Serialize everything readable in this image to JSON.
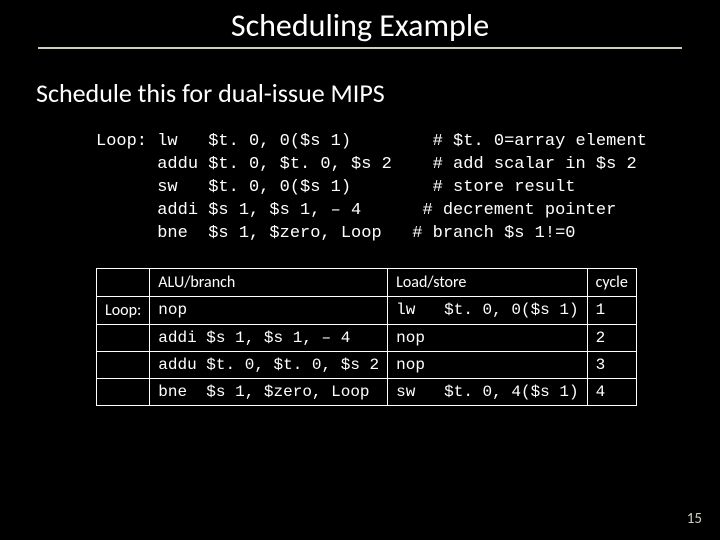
{
  "title": "Scheduling Example",
  "subtitle": "Schedule this for dual-issue MIPS",
  "code": "Loop: lw   $t. 0, 0($s 1)        # $t. 0=array element\n      addu $t. 0, $t. 0, $s 2    # add scalar in $s 2\n      sw   $t. 0, 0($s 1)        # store result\n      addi $s 1, $s 1, – 4      # decrement pointer\n      bne  $s 1, $zero, Loop   # branch $s 1!=0",
  "table": {
    "headers": [
      "",
      "ALU/branch",
      "Load/store",
      "cycle"
    ],
    "rows": [
      [
        "Loop:",
        "nop",
        "lw   $t. 0, 0($s 1)",
        "1"
      ],
      [
        "",
        "addi $s 1, $s 1, – 4",
        "nop",
        "2"
      ],
      [
        "",
        "addu $t. 0, $t. 0, $s 2",
        "nop",
        "3"
      ],
      [
        "",
        "bne  $s 1, $zero, Loop",
        "sw   $t. 0, 4($s 1)",
        "4"
      ]
    ]
  },
  "page": "15"
}
